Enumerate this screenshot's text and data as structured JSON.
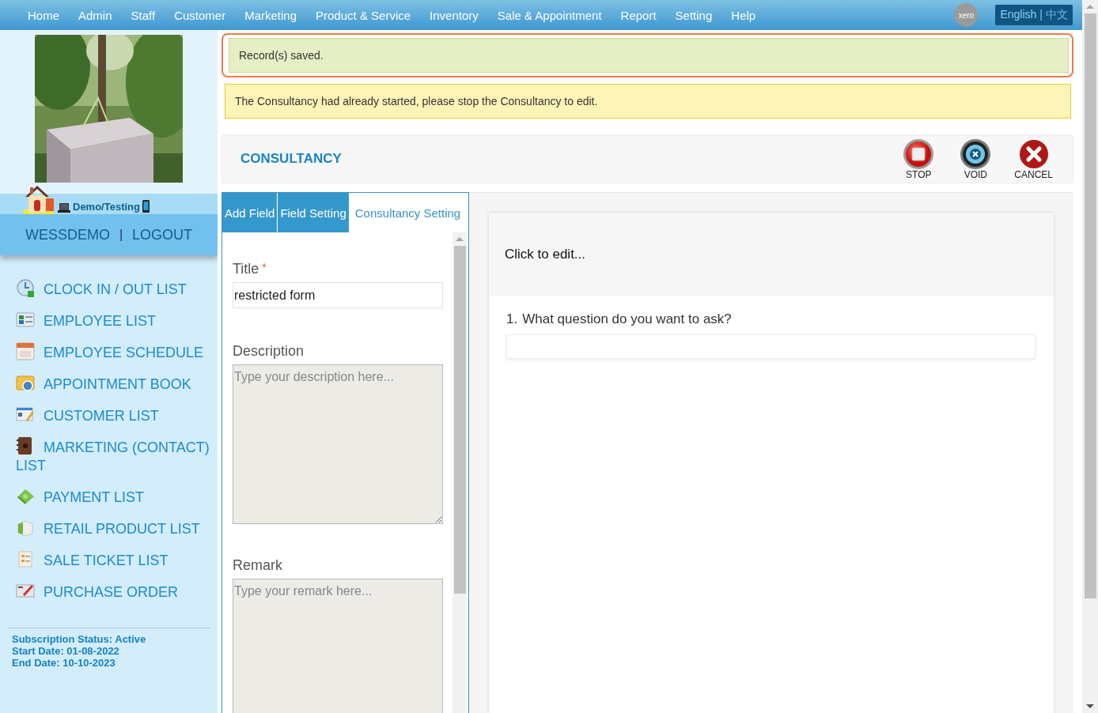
{
  "nav": {
    "items": [
      "Home",
      "Admin",
      "Staff",
      "Customer",
      "Marketing",
      "Product & Service",
      "Inventory",
      "Sale & Appointment",
      "Report",
      "Setting",
      "Help"
    ],
    "xero": "xero",
    "language": {
      "options": [
        {
          "label": "English",
          "selected": true
        },
        {
          "label": "中文",
          "selected": false
        }
      ],
      "separator": "|"
    }
  },
  "sidebar": {
    "user_band": {
      "label": "Demo/Testing"
    },
    "account": {
      "name": "WESSDEMO",
      "separator": "|",
      "logout": "LOGOUT"
    },
    "menu": [
      {
        "label": "CLOCK IN / OUT LIST"
      },
      {
        "label": "EMPLOYEE LIST"
      },
      {
        "label": "EMPLOYEE SCHEDULE"
      },
      {
        "label": "APPOINTMENT BOOK"
      },
      {
        "label": "CUSTOMER LIST"
      },
      {
        "label": "MARKETING (CONTACT) LIST"
      },
      {
        "label": "PAYMENT LIST"
      },
      {
        "label": "RETAIL PRODUCT LIST"
      },
      {
        "label": "SALE TICKET LIST"
      },
      {
        "label": "PURCHASE ORDER"
      }
    ],
    "subscription": [
      "Subscription Status: Active",
      "Start Date: 01-08-2022",
      "End Date: 10-10-2023"
    ]
  },
  "alerts": [
    {
      "kind": "success",
      "text": "Record(s) saved.",
      "highlighted": true
    },
    {
      "kind": "warning",
      "text": "The Consultancy had already started, please stop the Consultancy to edit."
    }
  ],
  "header": {
    "title": "CONSULTANCY",
    "actions": [
      {
        "kind": "stop",
        "label": "STOP"
      },
      {
        "kind": "void",
        "label": "VOID"
      },
      {
        "kind": "cancel",
        "label": "CANCEL"
      }
    ]
  },
  "tabs": [
    {
      "label": "Add Field",
      "selected": false
    },
    {
      "label": "Field Setting",
      "selected": false
    },
    {
      "label": "Consultancy Setting",
      "selected": true
    }
  ],
  "fields": [
    {
      "kind": "text",
      "label": "Title",
      "required_mark": "*",
      "value": "restricted form"
    },
    {
      "kind": "textarea",
      "label": "Description",
      "placeholder": "Type your description here..."
    },
    {
      "kind": "textarea",
      "label": "Remark",
      "placeholder": "Type your remark here..."
    }
  ],
  "preview": {
    "header": "Click to edit...",
    "questions": [
      {
        "number": "1.",
        "text": "What question do you want to ask?"
      }
    ]
  }
}
